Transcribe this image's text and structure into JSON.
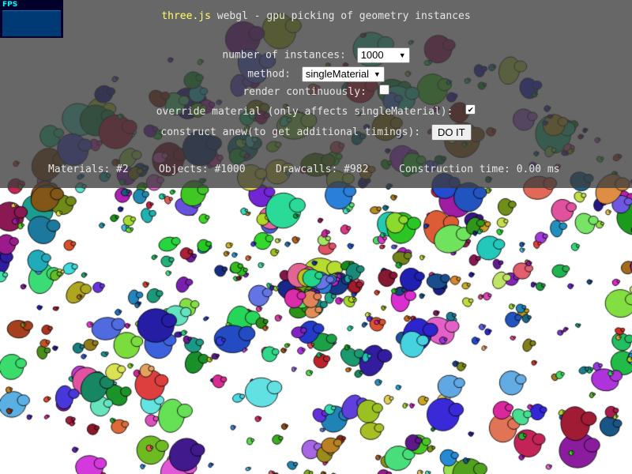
{
  "header": {
    "title_link": "three.js",
    "title_rest": " webgl - gpu picking of geometry instances"
  },
  "fps_panel": {
    "label": "FPS"
  },
  "controls": {
    "instances_label": "number of instances:",
    "instances_value": "1000",
    "method_label": "method:",
    "method_value": "singleMaterial",
    "render_label": "render continuously:",
    "render_checked": false,
    "override_label": "override material (only affects singleMaterial):",
    "override_checked": true,
    "override_mark": "✔",
    "construct_label": "construct anew(to get additional timings):",
    "construct_button": "DO IT"
  },
  "stats": {
    "materials": "Materials: #2",
    "objects": "Objects: #1000",
    "drawcalls": "Drawcalls: #982",
    "construction": "Construction time: 0.00 ms"
  },
  "colors": {
    "accent": "#ffff66",
    "overlay": "#3c3c3c",
    "fps_bg": "#00002a",
    "fps_text": "#00ffff"
  }
}
